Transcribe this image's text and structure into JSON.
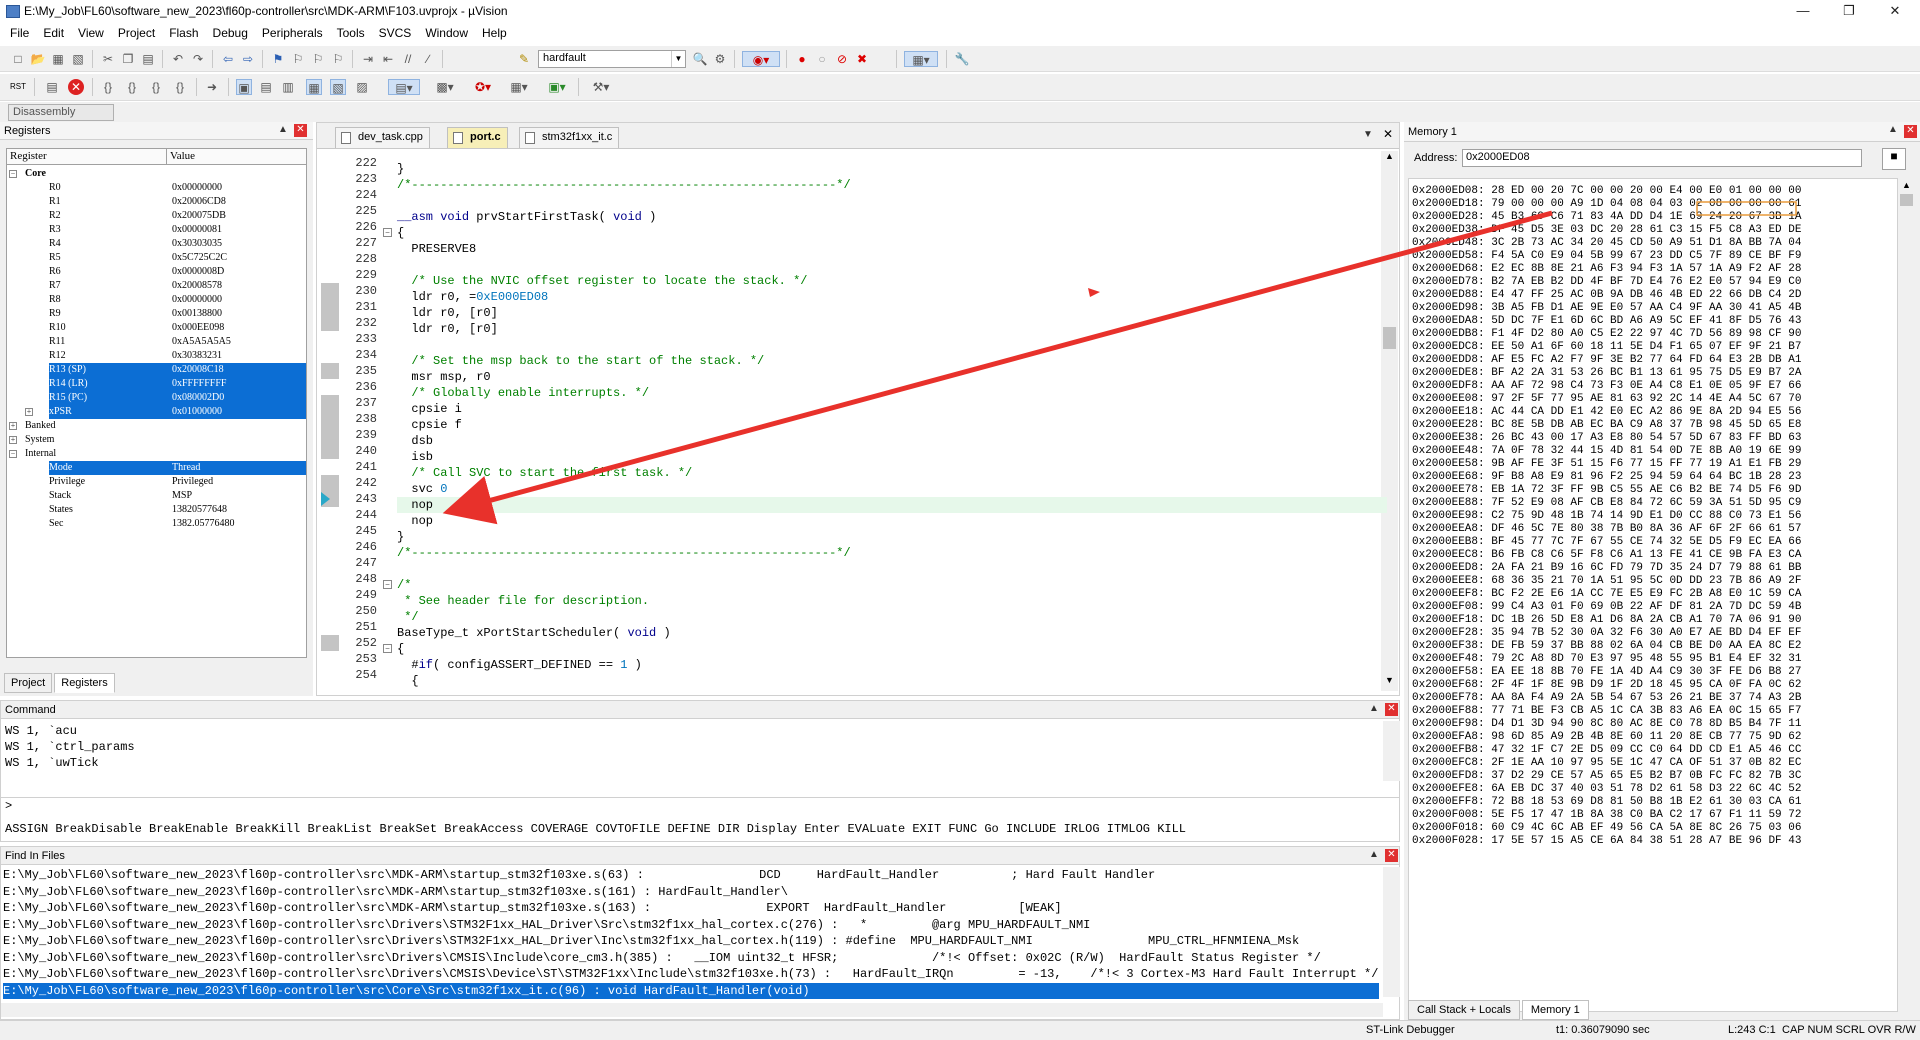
{
  "window": {
    "title": "E:\\My_Job\\FL60\\software_new_2023\\fl60p-controller\\src\\MDK-ARM\\F103.uvprojx - µVision"
  },
  "menu": [
    "File",
    "Edit",
    "View",
    "Project",
    "Flash",
    "Debug",
    "Peripherals",
    "Tools",
    "SVCS",
    "Window",
    "Help"
  ],
  "toolbar": {
    "search_value": "hardfault",
    "disassembly_label": "Disassembly",
    "rst_label": "RST"
  },
  "registers_panel": {
    "title": "Registers",
    "col_register": "Register",
    "col_value": "Value",
    "rows": [
      {
        "name": "Core",
        "value": "",
        "indent": 1,
        "group": true,
        "expanded": true
      },
      {
        "name": "R0",
        "value": "0x00000000",
        "indent": 2
      },
      {
        "name": "R1",
        "value": "0x20006CD8",
        "indent": 2
      },
      {
        "name": "R2",
        "value": "0x200075DB",
        "indent": 2
      },
      {
        "name": "R3",
        "value": "0x00000081",
        "indent": 2
      },
      {
        "name": "R4",
        "value": "0x30303035",
        "indent": 2
      },
      {
        "name": "R5",
        "value": "0x5C725C2C",
        "indent": 2
      },
      {
        "name": "R6",
        "value": "0x0000008D",
        "indent": 2
      },
      {
        "name": "R7",
        "value": "0x20008578",
        "indent": 2
      },
      {
        "name": "R8",
        "value": "0x00000000",
        "indent": 2
      },
      {
        "name": "R9",
        "value": "0x00138800",
        "indent": 2
      },
      {
        "name": "R10",
        "value": "0x000EE098",
        "indent": 2
      },
      {
        "name": "R11",
        "value": "0xA5A5A5A5",
        "indent": 2
      },
      {
        "name": "R12",
        "value": "0x30383231",
        "indent": 2
      },
      {
        "name": "R13 (SP)",
        "value": "0x20008C18",
        "indent": 2,
        "sel": true
      },
      {
        "name": "R14 (LR)",
        "value": "0xFFFFFFFF",
        "indent": 2,
        "sel": true
      },
      {
        "name": "R15 (PC)",
        "value": "0x080002D0",
        "indent": 2,
        "sel": true
      },
      {
        "name": "xPSR",
        "value": "0x01000000",
        "indent": 2,
        "sel": true,
        "expandable": true
      },
      {
        "name": "Banked",
        "value": "",
        "indent": 1,
        "group": true
      },
      {
        "name": "System",
        "value": "",
        "indent": 1,
        "group": true
      },
      {
        "name": "Internal",
        "value": "",
        "indent": 1,
        "group": true,
        "expanded": true
      },
      {
        "name": "Mode",
        "value": "Thread",
        "indent": 2,
        "sel": true
      },
      {
        "name": "Privilege",
        "value": "Privileged",
        "indent": 2
      },
      {
        "name": "Stack",
        "value": "MSP",
        "indent": 2
      },
      {
        "name": "States",
        "value": "13820577648",
        "indent": 2
      },
      {
        "name": "Sec",
        "value": "1382.05776480",
        "indent": 2
      }
    ],
    "tabs": [
      "Project",
      "Registers"
    ]
  },
  "editor": {
    "tabs": [
      "dev_task.cpp",
      "port.c",
      "stm32f1xx_it.c"
    ],
    "active_tab": 1,
    "lines": [
      {
        "n": "222",
        "t": "}"
      },
      {
        "n": "223",
        "t": "/*-----------------------------------------------------------*/",
        "c": "cm"
      },
      {
        "n": "224",
        "t": ""
      },
      {
        "n": "225",
        "t": "__asm void prvStartFirstTask( void )"
      },
      {
        "n": "226",
        "t": "{"
      },
      {
        "n": "227",
        "t": "  PRESERVE8"
      },
      {
        "n": "228",
        "t": ""
      },
      {
        "n": "229",
        "t": "  /* Use the NVIC offset register to locate the stack. */",
        "c": "cm"
      },
      {
        "n": "230",
        "t": "  ldr r0, =0xE000ED08"
      },
      {
        "n": "231",
        "t": "  ldr r0, [r0]"
      },
      {
        "n": "232",
        "t": "  ldr r0, [r0]"
      },
      {
        "n": "233",
        "t": ""
      },
      {
        "n": "234",
        "t": "  /* Set the msp back to the start of the stack. */",
        "c": "cm"
      },
      {
        "n": "235",
        "t": "  msr msp, r0"
      },
      {
        "n": "236",
        "t": "  /* Globally enable interrupts. */",
        "c": "cm"
      },
      {
        "n": "237",
        "t": "  cpsie i"
      },
      {
        "n": "238",
        "t": "  cpsie f"
      },
      {
        "n": "239",
        "t": "  dsb"
      },
      {
        "n": "240",
        "t": "  isb"
      },
      {
        "n": "241",
        "t": "  /* Call SVC to start the first task. */",
        "c": "cm"
      },
      {
        "n": "242",
        "t": "  svc 0"
      },
      {
        "n": "243",
        "t": "  nop",
        "cur": true
      },
      {
        "n": "244",
        "t": "  nop"
      },
      {
        "n": "245",
        "t": "}"
      },
      {
        "n": "246",
        "t": "/*-----------------------------------------------------------*/",
        "c": "cm"
      },
      {
        "n": "247",
        "t": ""
      },
      {
        "n": "248",
        "t": "/*",
        "c": "cm"
      },
      {
        "n": "249",
        "t": " * See header file for description.",
        "c": "cm"
      },
      {
        "n": "250",
        "t": " */",
        "c": "cm"
      },
      {
        "n": "251",
        "t": "BaseType_t xPortStartScheduler( void )"
      },
      {
        "n": "252",
        "t": "{"
      },
      {
        "n": "253",
        "t": "  #if( configASSERT_DEFINED == 1 )"
      },
      {
        "n": "254",
        "t": "  {"
      }
    ]
  },
  "memory_panel": {
    "title": "Memory 1",
    "address_label": "Address:",
    "address_value": "0x2000ED08",
    "rows": [
      "0x2000ED08: 28 ED 00 20 7C 00 00 20 00 E4 00 E0 01 00 00 00",
      "0x2000ED18: 79 00 00 00 A9 1D 04 08 04 03 02 08 00 00 00 61",
      "0x2000ED28: 45 B3 69 C6 71 83 4A DD D4 1E 69 24 20 67 3B 1A",
      "0x2000ED38: DF 45 D5 3E 03 DC 20 28 61 C3 15 F5 C8 A3 ED DE",
      "0x2000ED48: 3C 2B 73 AC 34 20 45 CD 50 A9 51 D1 8A BB 7A 04",
      "0x2000ED58: F4 5A C0 E9 04 5B 99 67 23 DD C5 7F 89 CE BF F9",
      "0x2000ED68: E2 EC 8B 8E 21 A6 F3 94 F3 1A 57 1A A9 F2 AF 28",
      "0x2000ED78: B2 7A EB B2 DD 4F BF 7D E4 76 E2 E0 57 94 E9 C0",
      "0x2000ED88: E4 47 FF 25 AC 0B 9A DB 46 4B ED 22 66 DB C4 2D",
      "0x2000ED98: 3B A5 FB D1 AE 9E E0 57 AA C4 9F AA 30 41 A5 4B",
      "0x2000EDA8: 5D DC 7F E1 6D 6C BD A6 A9 5C EF 41 8F D5 76 43",
      "0x2000EDB8: F1 4F D2 80 A0 C5 E2 22 97 4C 7D 56 89 98 CF 90",
      "0x2000EDC8: EE 50 A1 6F 60 18 11 5E D4 F1 65 07 EF 9F 21 B7",
      "0x2000EDD8: AF E5 FC A2 F7 9F 3E B2 77 64 FD 64 E3 2B DB A1",
      "0x2000EDE8: BF A2 2A 31 53 26 BC B1 13 61 95 75 D5 E9 B7 2A",
      "0x2000EDF8: AA AF 72 98 C4 73 F3 0E A4 C8 E1 0E 05 9F E7 66",
      "0x2000EE08: 97 2F 5F 77 95 AE 81 63 92 2C 14 4E A4 5C 67 70",
      "0x2000EE18: AC 44 CA DD E1 42 E0 EC A2 86 9E 8A 2D 94 E5 56",
      "0x2000EE28: BC 8E 5B DB AB EC BA C9 A8 37 7B 98 45 5D 65 E8",
      "0x2000EE38: 26 BC 43 00 17 A3 E8 80 54 57 5D 67 83 FF BD 63",
      "0x2000EE48: 7A 0F 78 32 44 15 4D 81 54 0D 7E 8B A0 19 6E 99",
      "0x2000EE58: 9B AF FE 3F 51 15 F6 77 15 FF 77 19 A1 E1 FB 29",
      "0x2000EE68: 9F B8 A8 E9 81 96 F2 25 94 59 64 64 BC 1B 28 23",
      "0x2000EE78: EB 1A 72 3F FF 9B C5 55 AE C6 B2 BE 74 D5 F6 9D",
      "0x2000EE88: 7F 52 E9 08 AF CB E8 84 72 6C 59 3A 51 5D 95 C9",
      "0x2000EE98: C2 75 9D 48 1B 74 14 9D E1 D0 CC 88 C0 73 E1 56",
      "0x2000EEA8: DF 46 5C 7E 80 38 7B B0 8A 36 AF 6F 2F 66 61 57",
      "0x2000EEB8: BF 45 77 7C 7F 67 55 CE 74 32 5E D5 F9 EC EA 66",
      "0x2000EEC8: B6 FB C8 C6 5F F8 C6 A1 13 FE 41 CE 9B FA E3 CA",
      "0x2000EED8: 2A FA 21 B9 16 6C FD 79 7D 35 24 D7 79 88 61 BB",
      "0x2000EEE8: 68 36 35 21 70 1A 51 95 5C 0D DD 23 7B 86 A9 2F",
      "0x2000EEF8: BC F2 2E E6 1A CC 7E E5 E9 FC 2B A8 E0 1C 59 CA",
      "0x2000EF08: 99 C4 A3 01 F0 69 0B 22 AF DF 81 2A 7D DC 59 4B",
      "0x2000EF18: DC 1B 26 5D E8 A1 D6 8A 2A CB A1 70 7A 06 91 90",
      "0x2000EF28: 35 94 7B 52 30 0A 32 F6 30 A0 E7 AE BD D4 EF EF",
      "0x2000EF38: DE FB 59 37 BB 88 02 6A 04 CB BE D0 AA EA 8C E2",
      "0x2000EF48: 79 2C A8 8D 70 E3 97 95 48 55 95 B1 E4 EF 32 31",
      "0x2000EF58: EA EE 18 8B 70 FE 1A 4D A4 C9 30 3F FE D6 B8 27",
      "0x2000EF68: 2F 4F 1F 8E 9B D9 1F 2D 18 45 95 CA 0F FA 0C 62",
      "0x2000EF78: AA 8A F4 A9 2A 5B 54 67 53 26 21 BE 37 74 A3 2B",
      "0x2000EF88: 77 71 BE F3 CB A5 1C CA 3B 83 A6 EA 0C 15 65 F7",
      "0x2000EF98: D4 D1 3D 94 90 8C 80 AC 8E C0 78 8D B5 B4 7F 11",
      "0x2000EFA8: 98 6D 85 A9 2B 4B 8E 60 11 20 8E CB 77 75 9D 62",
      "0x2000EFB8: 47 32 1F C7 2E D5 09 CC C0 64 DD CD E1 A5 46 CC",
      "0x2000EFC8: 2F 1E AA 10 97 95 5E 1C 47 CA OF 51 37 0B 82 EC",
      "0x2000EFD8: 37 D2 29 CE 57 A5 65 E5 B2 B7 0B FC FC 82 7B 3C",
      "0x2000EFE8: 6A EB DC 37 40 03 51 78 D2 61 58 D3 22 6C 4C 52",
      "0x2000EFF8: 72 B8 18 53 69 D8 81 50 B8 1B E2 61 30 03 CA 61",
      "0x2000F008: 5E F5 17 47 1B 8A 38 C0 BA C2 17 67 F1 11 59 72",
      "0x2000F018: 60 C9 4C 6C AB EF 49 56 CA 5A 8E 8C 26 75 03 06",
      "0x2000F028: 17 5E 57 15 A5 CE 6A 84 38 51 28 A7 BE 96 DF 43"
    ],
    "tabs": [
      "Call Stack + Locals",
      "Memory 1"
    ]
  },
  "command_panel": {
    "title": "Command",
    "lines": [
      "WS 1, `acu",
      "WS 1, `ctrl_params",
      "WS 1, `uwTick"
    ],
    "prompt": ">",
    "help": "ASSIGN BreakDisable BreakEnable BreakKill BreakList BreakSet BreakAccess COVERAGE COVTOFILE DEFINE DIR Display Enter EVALuate EXIT FUNC Go INCLUDE IRLOG ITMLOG KILL"
  },
  "find_panel": {
    "title": "Find In Files",
    "rows": [
      "E:\\My_Job\\FL60\\software_new_2023\\fl60p-controller\\src\\MDK-ARM\\startup_stm32f103xe.s(63) :                DCD     HardFault_Handler          ; Hard Fault Handler",
      "E:\\My_Job\\FL60\\software_new_2023\\fl60p-controller\\src\\MDK-ARM\\startup_stm32f103xe.s(161) : HardFault_Handler\\",
      "E:\\My_Job\\FL60\\software_new_2023\\fl60p-controller\\src\\MDK-ARM\\startup_stm32f103xe.s(163) :                EXPORT  HardFault_Handler          [WEAK]",
      "E:\\My_Job\\FL60\\software_new_2023\\fl60p-controller\\src\\Drivers\\STM32F1xx_HAL_Driver\\Src\\stm32f1xx_hal_cortex.c(276) :   *         @arg MPU_HARDFAULT_NMI",
      "E:\\My_Job\\FL60\\software_new_2023\\fl60p-controller\\src\\Drivers\\STM32F1xx_HAL_Driver\\Inc\\stm32f1xx_hal_cortex.h(119) : #define  MPU_HARDFAULT_NMI                MPU_CTRL_HFNMIENA_Msk",
      "E:\\My_Job\\FL60\\software_new_2023\\fl60p-controller\\src\\Drivers\\CMSIS\\Include\\core_cm3.h(385) :   __IOM uint32_t HFSR;             /*!< Offset: 0x02C (R/W)  HardFault Status Register */",
      "E:\\My_Job\\FL60\\software_new_2023\\fl60p-controller\\src\\Drivers\\CMSIS\\Device\\ST\\STM32F1xx\\Include\\stm32f103xe.h(73) :   HardFault_IRQn         = -13,    /*!< 3 Cortex-M3 Hard Fault Interrupt */",
      "E:\\My_Job\\FL60\\software_new_2023\\fl60p-controller\\src\\Core\\Src\\stm32f1xx_it.c(96) : void HardFault_Handler(void)"
    ],
    "selected_row": 7
  },
  "status": {
    "debugger": "ST-Link Debugger",
    "time": "t1: 0.36079090 sec",
    "position": "L:243 C:1",
    "flags": "CAP NUM SCRL OVR R/W"
  },
  "colors": {
    "selection": "#0c6ed4",
    "annotation_arrow": "#e8312b",
    "current_line": "#e6f8ea"
  }
}
